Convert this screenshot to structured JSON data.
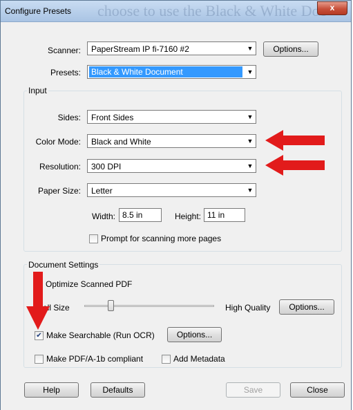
{
  "window": {
    "title": "Configure Presets",
    "watermark": "choose to use the Black & White Doc",
    "close_glyph": "x"
  },
  "scanner": {
    "label": "Scanner:",
    "value": "PaperStream IP fi-7160 #2",
    "options_label": "Options..."
  },
  "presets": {
    "label": "Presets:",
    "value": "Black & White Document"
  },
  "input": {
    "group_title": "Input",
    "sides": {
      "label": "Sides:",
      "value": "Front Sides"
    },
    "color_mode": {
      "label": "Color Mode:",
      "value": "Black and White"
    },
    "resolution": {
      "label": "Resolution:",
      "value": "300 DPI"
    },
    "paper_size": {
      "label": "Paper Size:",
      "value": "Letter"
    },
    "width": {
      "label": "Width:",
      "value": "8.5 in"
    },
    "height": {
      "label": "Height:",
      "value": "11 in"
    },
    "prompt_more_pages": {
      "label": "Prompt for scanning more pages",
      "checked": false
    }
  },
  "document_settings": {
    "group_title": "Document Settings",
    "optimize_label": "Optimize Scanned PDF",
    "small_size_label": "all Size",
    "high_quality_label": "High Quality",
    "quality_level": 0.2,
    "options_label": "Options...",
    "make_searchable": {
      "label": "Make Searchable (Run OCR)",
      "checked": true
    },
    "ocr_options_label": "Options...",
    "pdfa": {
      "label": "Make PDF/A-1b compliant",
      "checked": false
    },
    "metadata": {
      "label": "Add Metadata",
      "checked": false
    }
  },
  "footer": {
    "help": "Help",
    "defaults": "Defaults",
    "save": "Save",
    "close": "Close"
  },
  "colors": {
    "arrow": "#e21b1b",
    "selection": "#3399ff"
  },
  "icons": {
    "dropdown": "chevron-down-icon",
    "annotation": "red-arrow-icon"
  }
}
